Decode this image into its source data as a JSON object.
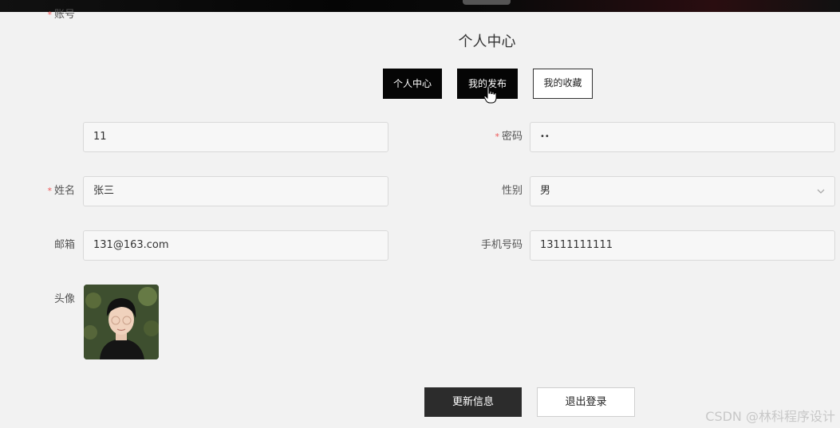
{
  "page": {
    "title": "个人中心"
  },
  "tabs": [
    {
      "label": "个人中心",
      "active": true
    },
    {
      "label": "我的发布",
      "active": true
    },
    {
      "label": "我的收藏",
      "active": false
    }
  ],
  "form": {
    "account": {
      "label": "账号",
      "required": "*",
      "value": "11"
    },
    "password": {
      "label": "密码",
      "required": "*",
      "value": "••"
    },
    "name": {
      "label": "姓名",
      "required": "*",
      "value": "张三"
    },
    "gender": {
      "label": "性别",
      "value": "男"
    },
    "email": {
      "label": "邮箱",
      "value": "131@163.com"
    },
    "phone": {
      "label": "手机号码",
      "value": "13111111111"
    },
    "avatar": {
      "label": "头像"
    }
  },
  "actions": {
    "update": "更新信息",
    "logout": "退出登录"
  },
  "watermark": "CSDN @林科程序设计",
  "colors": {
    "dark": "#050505",
    "background": "#f2f2f2",
    "required": "#e55555"
  }
}
